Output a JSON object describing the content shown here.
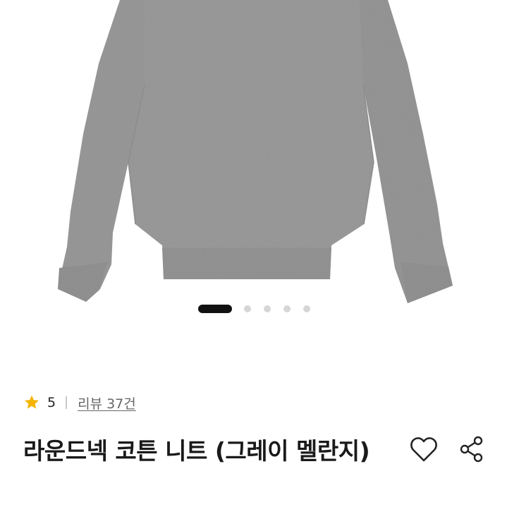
{
  "product": {
    "image_icon": "gray-melange-round-neck-sweater",
    "title": "라운드넥 코튼 니트 (그레이 멜란지)",
    "rating": "5",
    "review_link": "리뷰 37건"
  },
  "gallery": {
    "total_images": 5,
    "active_index": 1
  },
  "icons": {
    "rating": "star-icon",
    "wishlist": "heart-outline-icon",
    "share": "share-icon"
  },
  "colors": {
    "star": "#F5B400",
    "sweater": "#9a9a9a",
    "active_dot": "#111111",
    "inactive_dot": "#d6d6d6"
  }
}
